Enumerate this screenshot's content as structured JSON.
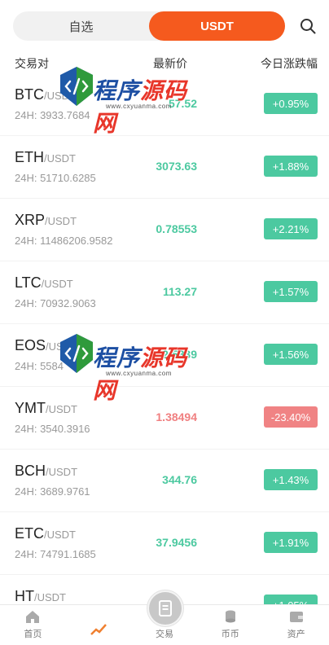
{
  "segment": {
    "tabs": [
      {
        "label": "自选"
      },
      {
        "label": "USDT"
      }
    ],
    "active": "USDT"
  },
  "header": {
    "pair": "交易对",
    "price": "最新价",
    "change": "今日涨跌幅"
  },
  "rows": [
    {
      "base": "BTC",
      "quote": "/USDT",
      "vol": "24H: 3933.7684",
      "price": "57.52",
      "change": "+0.95%",
      "dir": "up"
    },
    {
      "base": "ETH",
      "quote": "/USDT",
      "vol": "24H: 51710.6285",
      "price": "3073.63",
      "change": "+1.88%",
      "dir": "up"
    },
    {
      "base": "XRP",
      "quote": "/USDT",
      "vol": "24H: 11486206.9582",
      "price": "0.78553",
      "change": "+2.21%",
      "dir": "up"
    },
    {
      "base": "LTC",
      "quote": "/USDT",
      "vol": "24H: 70932.9063",
      "price": "113.27",
      "change": "+1.57%",
      "dir": "up"
    },
    {
      "base": "EOS",
      "quote": "/USDT",
      "vol": "24H: 5584",
      "price": "2.5839",
      "change": "+1.56%",
      "dir": "up"
    },
    {
      "base": "YMT",
      "quote": "/USDT",
      "vol": "24H: 3540.3916",
      "price": "1.38494",
      "change": "-23.40%",
      "dir": "down"
    },
    {
      "base": "BCH",
      "quote": "/USDT",
      "vol": "24H: 3689.9761",
      "price": "344.76",
      "change": "+1.43%",
      "dir": "up"
    },
    {
      "base": "ETC",
      "quote": "/USDT",
      "vol": "24H: 74791.1685",
      "price": "37.9456",
      "change": "+1.91%",
      "dir": "up"
    },
    {
      "base": "HT",
      "quote": "/USDT",
      "vol": "",
      "price": "",
      "change": "+1.05%",
      "dir": "up"
    }
  ],
  "watermark": {
    "text_a": "程序",
    "text_b": "源码网",
    "url": "www.cxyuanma.com"
  },
  "nav": [
    {
      "label": "首页",
      "icon": "home-icon"
    },
    {
      "label": "",
      "icon": "chart-icon"
    },
    {
      "label": "交易",
      "icon": "trade-icon"
    },
    {
      "label": "币币",
      "icon": "coins-icon"
    },
    {
      "label": "资产",
      "icon": "wallet-icon"
    }
  ],
  "colors": {
    "accent": "#f55a1e",
    "up": "#4cc9a0",
    "down": "#f08384"
  }
}
